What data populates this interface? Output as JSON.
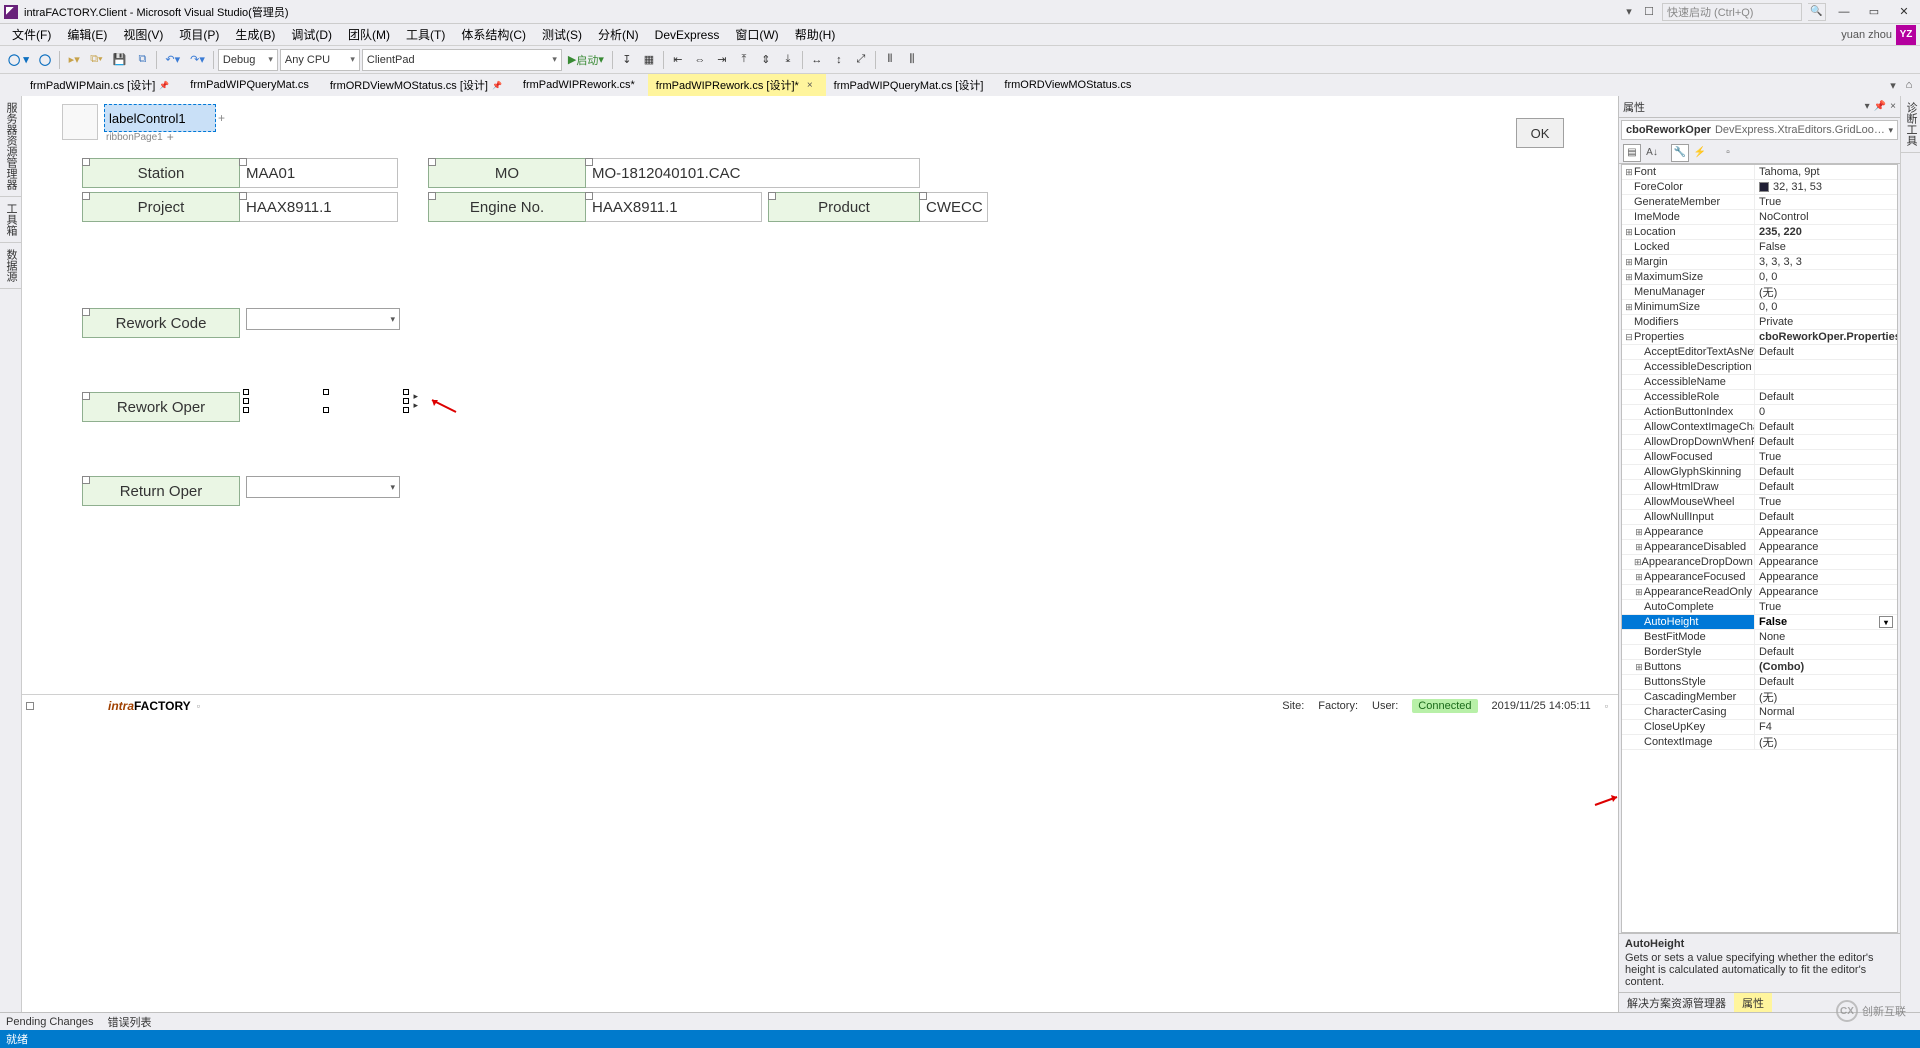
{
  "window": {
    "title": "intraFACTORY.Client - Microsoft Visual Studio(管理员)",
    "search_placeholder": "快速启动 (Ctrl+Q)",
    "user": "yuan zhou",
    "user_initials": "YZ"
  },
  "menu": [
    "文件(F)",
    "编辑(E)",
    "视图(V)",
    "项目(P)",
    "生成(B)",
    "调试(D)",
    "团队(M)",
    "工具(T)",
    "体系结构(C)",
    "测试(S)",
    "分析(N)",
    "DevExpress",
    "窗口(W)",
    "帮助(H)"
  ],
  "toolbar": {
    "config": "Debug",
    "platform": "Any CPU",
    "target": "ClientPad",
    "start_label": "启动"
  },
  "tabs": [
    {
      "label": "frmPadWIPMain.cs [设计]",
      "pinned": true,
      "active": false
    },
    {
      "label": "frmPadWIPQueryMat.cs",
      "pinned": false,
      "active": false
    },
    {
      "label": "frmORDViewMOStatus.cs [设计]",
      "pinned": false,
      "active": false
    },
    {
      "label": "frmPadWIPRework.cs*",
      "pinned": false,
      "active": false
    },
    {
      "label": "frmPadWIPRework.cs [设计]*",
      "pinned": false,
      "active": true
    },
    {
      "label": "frmPadWIPQueryMat.cs [设计]",
      "pinned": false,
      "active": false
    },
    {
      "label": "frmORDViewMOStatus.cs",
      "pinned": false,
      "active": false
    }
  ],
  "side_tabs": [
    "服务器资源管理器",
    "工具箱",
    "数据源"
  ],
  "right_side_tab": "诊断工具",
  "designer": {
    "ribbon_tab_text": "labelControl1",
    "ribbon_page": "ribbonPage1",
    "ok_button": "OK",
    "fields": {
      "station_label": "Station",
      "station_value": "MAA01",
      "mo_label": "MO",
      "mo_value": "MO-1812040101.CAC",
      "project_label": "Project",
      "project_value": "HAAX8911.1",
      "engine_label": "Engine No.",
      "engine_value": "HAAX8911.1",
      "product_label": "Product",
      "product_value": "CWECC",
      "rework_code_label": "Rework Code",
      "rework_oper_label": "Rework Oper",
      "return_oper_label": "Return Oper"
    },
    "footer": {
      "brand_a": "intra",
      "brand_b": "FACTORY",
      "site_label": "Site:",
      "factory_label": "Factory:",
      "user_label": "User:",
      "connected": "Connected",
      "datetime": "2019/11/25 14:05:11"
    }
  },
  "properties": {
    "panel_title": "属性",
    "obj_name": "cboReworkOper",
    "obj_type": "DevExpress.XtraEditors.GridLookUpEdit",
    "rows": [
      {
        "n": "Font",
        "v": "Tahoma, 9pt",
        "exp": "+"
      },
      {
        "n": "ForeColor",
        "v": "32, 31, 53",
        "swatch": true
      },
      {
        "n": "GenerateMember",
        "v": "True"
      },
      {
        "n": "ImeMode",
        "v": "NoControl"
      },
      {
        "n": "Location",
        "v": "235, 220",
        "exp": "+",
        "bold": true
      },
      {
        "n": "Locked",
        "v": "False"
      },
      {
        "n": "Margin",
        "v": "3, 3, 3, 3",
        "exp": "+"
      },
      {
        "n": "MaximumSize",
        "v": "0, 0",
        "exp": "+"
      },
      {
        "n": "MenuManager",
        "v": "(无)"
      },
      {
        "n": "MinimumSize",
        "v": "0, 0",
        "exp": "+"
      },
      {
        "n": "Modifiers",
        "v": "Private"
      },
      {
        "n": "Properties",
        "v": "cboReworkOper.Properties",
        "exp": "-",
        "bold": true
      },
      {
        "n": "AcceptEditorTextAsNew",
        "v": "Default",
        "indent": true
      },
      {
        "n": "AccessibleDescription",
        "v": "",
        "indent": true
      },
      {
        "n": "AccessibleName",
        "v": "",
        "indent": true
      },
      {
        "n": "AccessibleRole",
        "v": "Default",
        "indent": true
      },
      {
        "n": "ActionButtonIndex",
        "v": "0",
        "indent": true
      },
      {
        "n": "AllowContextImageCha",
        "v": "Default",
        "indent": true
      },
      {
        "n": "AllowDropDownWhenR",
        "v": "Default",
        "indent": true
      },
      {
        "n": "AllowFocused",
        "v": "True",
        "indent": true
      },
      {
        "n": "AllowGlyphSkinning",
        "v": "Default",
        "indent": true
      },
      {
        "n": "AllowHtmlDraw",
        "v": "Default",
        "indent": true
      },
      {
        "n": "AllowMouseWheel",
        "v": "True",
        "indent": true
      },
      {
        "n": "AllowNullInput",
        "v": "Default",
        "indent": true
      },
      {
        "n": "Appearance",
        "v": "Appearance",
        "indent": true,
        "exp": "+"
      },
      {
        "n": "AppearanceDisabled",
        "v": "Appearance",
        "indent": true,
        "exp": "+"
      },
      {
        "n": "AppearanceDropDown",
        "v": "Appearance",
        "indent": true,
        "exp": "+"
      },
      {
        "n": "AppearanceFocused",
        "v": "Appearance",
        "indent": true,
        "exp": "+"
      },
      {
        "n": "AppearanceReadOnly",
        "v": "Appearance",
        "indent": true,
        "exp": "+"
      },
      {
        "n": "AutoComplete",
        "v": "True",
        "indent": true
      },
      {
        "n": "AutoHeight",
        "v": "False",
        "indent": true,
        "selected": true,
        "bold": true,
        "drop": true
      },
      {
        "n": "BestFitMode",
        "v": "None",
        "indent": true
      },
      {
        "n": "BorderStyle",
        "v": "Default",
        "indent": true
      },
      {
        "n": "Buttons",
        "v": "(Combo)",
        "indent": true,
        "exp": "+",
        "bold": true
      },
      {
        "n": "ButtonsStyle",
        "v": "Default",
        "indent": true
      },
      {
        "n": "CascadingMember",
        "v": "(无)",
        "indent": true
      },
      {
        "n": "CharacterCasing",
        "v": "Normal",
        "indent": true
      },
      {
        "n": "CloseUpKey",
        "v": "F4",
        "indent": true
      },
      {
        "n": "ContextImage",
        "v": "(无)",
        "indent": true
      }
    ],
    "desc_title": "AutoHeight",
    "desc_body": "Gets or sets a value specifying whether the editor's height is calculated automatically to fit the editor's content.",
    "tabs": [
      "解决方案资源管理器",
      "属性"
    ]
  },
  "bottom_tabs": [
    "Pending Changes",
    "错误列表"
  ],
  "statusbar": "就绪",
  "watermark": "创新互联"
}
